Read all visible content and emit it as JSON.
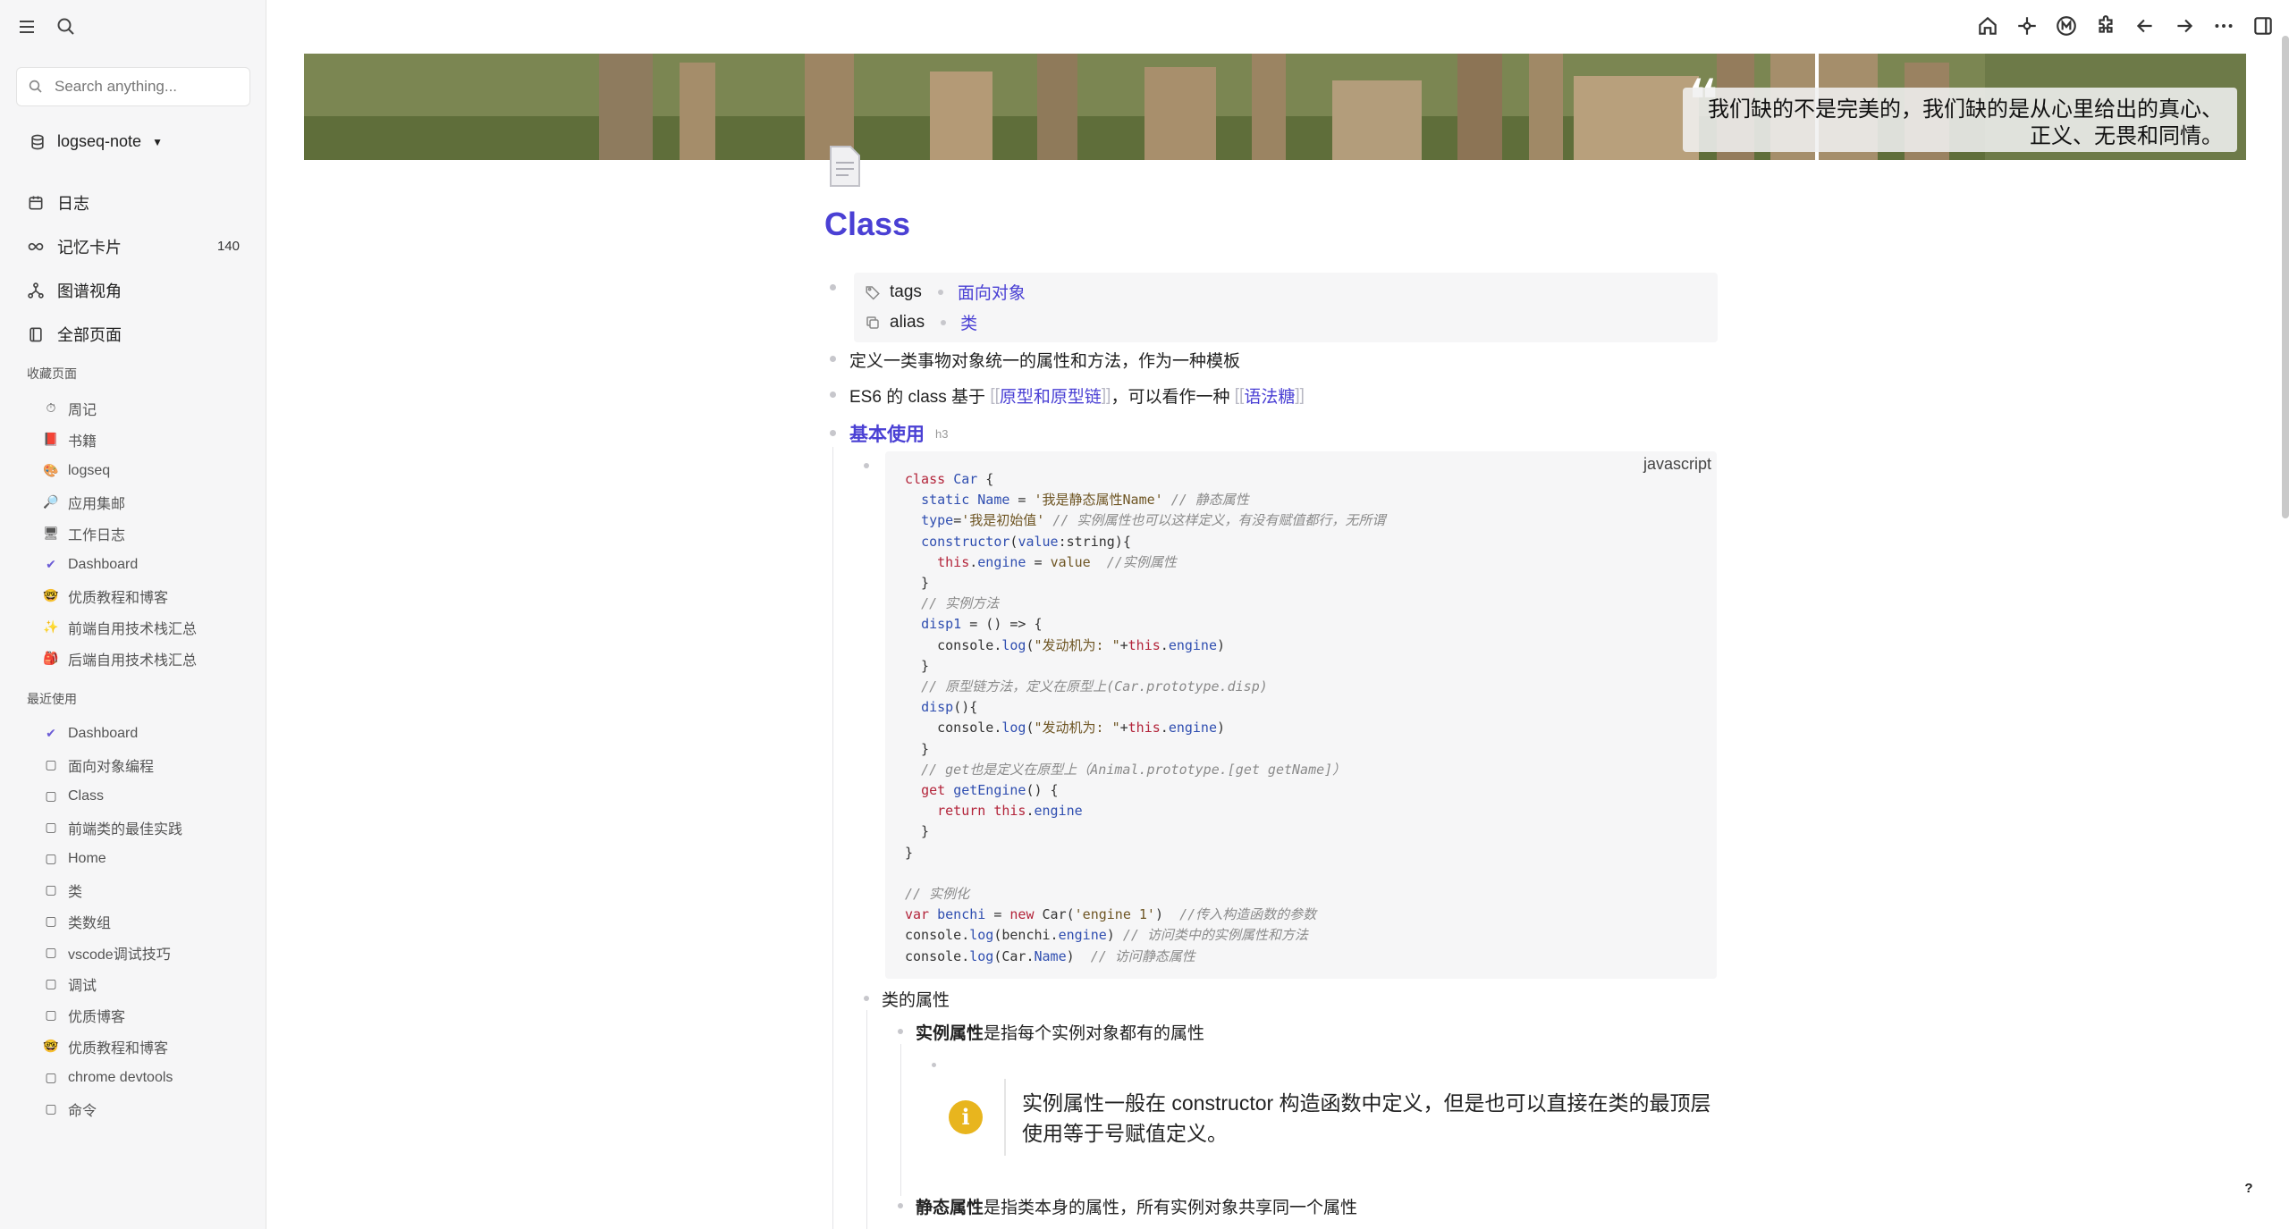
{
  "sidebar": {
    "search_placeholder": "Search anything...",
    "graph_name": "logseq-note",
    "nav": [
      {
        "label": "日志",
        "icon": "calendar-icon"
      },
      {
        "label": "记忆卡片",
        "icon": "infinity-icon",
        "badge": "140"
      },
      {
        "label": "图谱视角",
        "icon": "graph-icon"
      },
      {
        "label": "全部页面",
        "icon": "pages-icon"
      }
    ],
    "favorites_title": "收藏页面",
    "favorites": [
      {
        "label": "周记",
        "icon": "⏱"
      },
      {
        "label": "书籍",
        "icon": "📕"
      },
      {
        "label": "logseq",
        "icon": "🎨"
      },
      {
        "label": "应用集邮",
        "icon": "🔎"
      },
      {
        "label": "工作日志",
        "icon": "🖥"
      },
      {
        "label": "Dashboard",
        "icon": "✔"
      },
      {
        "label": "优质教程和博客",
        "icon": "🤓"
      },
      {
        "label": "前端自用技术栈汇总",
        "icon": "✨"
      },
      {
        "label": "后端自用技术栈汇总",
        "icon": "🎒"
      }
    ],
    "recent_title": "最近使用",
    "recent": [
      {
        "label": "Dashboard",
        "icon": "✔"
      },
      {
        "label": "面向对象编程",
        "icon": "▢"
      },
      {
        "label": "Class",
        "icon": "▢"
      },
      {
        "label": "前端类的最佳实践",
        "icon": "▢"
      },
      {
        "label": "Home",
        "icon": "▢"
      },
      {
        "label": "类",
        "icon": "▢"
      },
      {
        "label": "类数组",
        "icon": "▢"
      },
      {
        "label": "vscode调试技巧",
        "icon": "▢"
      },
      {
        "label": "调试",
        "icon": "▢"
      },
      {
        "label": "优质博客",
        "icon": "▢"
      },
      {
        "label": "优质教程和博客",
        "icon": "🤓"
      },
      {
        "label": "chrome devtools",
        "icon": "▢"
      },
      {
        "label": "命令",
        "icon": "▢"
      }
    ]
  },
  "banner": {
    "quote_line1": "我们缺的不是完美的，我们缺的是从心里给出的真心、",
    "quote_line2": "正义、无畏和同情。"
  },
  "page": {
    "title": "Class",
    "props": {
      "tags_key": "tags",
      "tags_val": "面向对象",
      "alias_key": "alias",
      "alias_val": "类"
    },
    "line1": "定义一类事物对象统一的属性和方法，作为一种模板",
    "line2_a": "ES6 的 class 基于",
    "line2_ref1": "原型和原型链",
    "line2_b": "，可以看作一种",
    "line2_ref2": "语法糖",
    "heading": "基本使用",
    "heading_tag": "h3",
    "code_lang": "javascript",
    "sub_heading": "类的属性",
    "instance_bold": "实例属性",
    "instance_rest": "是指每个实例对象都有的属性",
    "callout_text": "实例属性一般在 constructor 构造函数中定义，但是也可以直接在类的最顶层使用等于号赋值定义。",
    "static_bold": "静态属性",
    "static_rest": "是指类本身的属性，所有实例对象共享同一个属性"
  },
  "help_label": "?"
}
